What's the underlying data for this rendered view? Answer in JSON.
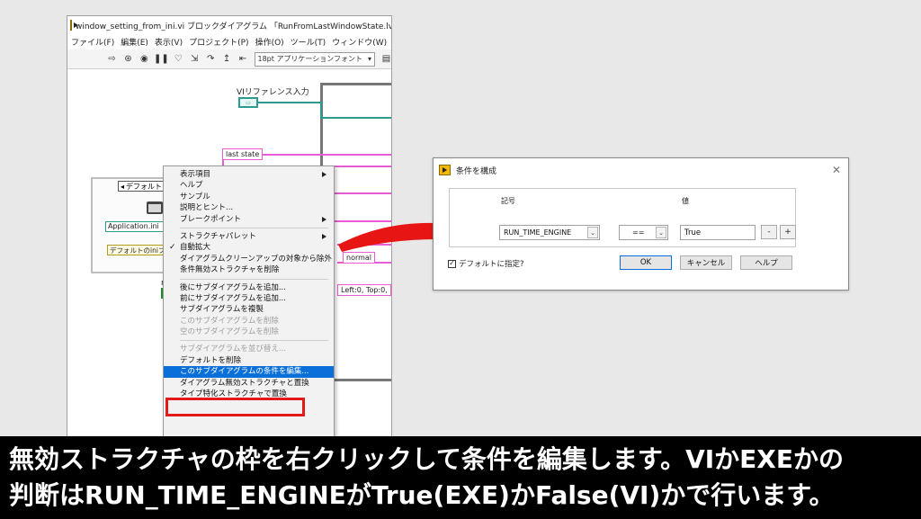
{
  "main_window": {
    "title": "window_setting_from_ini.vi ブロックダイアグラム 「RunFromLastWindowState.lvproj/マイ",
    "menu": [
      "ファイル(F)",
      "編集(E)",
      "表示(V)",
      "プロジェクト(P)",
      "操作(O)",
      "ツール(T)",
      "ウィンドウ(W)",
      "ヘル"
    ],
    "toolbar": {
      "font_select": "18pt アプリケーションフォント",
      "icons": [
        "run-arrow-icon",
        "retain-wire-icon",
        "abort-icon",
        "pause-icon",
        "highlight-bulb-icon",
        "step-into-icon",
        "step-over-icon",
        "step-out-icon",
        "align-icon"
      ]
    },
    "diagram": {
      "vi_ref_label": "VIリファレンス入力",
      "last_state": "last state",
      "normal": "normal",
      "left_top": "Left:0, Top:0,",
      "case_selector": "デフォルト",
      "app_box": "Application.ini",
      "default_ini": "デフォルトのiniフ",
      "small_r": "r"
    }
  },
  "context_menu": {
    "groups": [
      [
        {
          "label": "表示項目",
          "submenu": true,
          "disabled": false
        },
        {
          "label": "ヘルプ",
          "submenu": false,
          "disabled": false
        },
        {
          "label": "サンプル",
          "submenu": false,
          "disabled": false
        },
        {
          "label": "説明とヒント...",
          "submenu": false,
          "disabled": false
        },
        {
          "label": "ブレークポイント",
          "submenu": true,
          "disabled": false
        }
      ],
      [
        {
          "label": "ストラクチャパレット",
          "submenu": true,
          "disabled": false
        },
        {
          "label": "自動拡大",
          "submenu": false,
          "disabled": false,
          "checked": true
        },
        {
          "label": "ダイアグラムクリーンアップの対象から除外",
          "submenu": false,
          "disabled": false
        },
        {
          "label": "条件無効ストラクチャを削除",
          "submenu": false,
          "disabled": false
        }
      ],
      [
        {
          "label": "後にサブダイアグラムを追加...",
          "submenu": false,
          "disabled": false
        },
        {
          "label": "前にサブダイアグラムを追加...",
          "submenu": false,
          "disabled": false
        },
        {
          "label": "サブダイアグラムを複製",
          "submenu": false,
          "disabled": false
        },
        {
          "label": "このサブダイアグラムを削除",
          "submenu": false,
          "disabled": true
        },
        {
          "label": "空のサブダイアグラムを削除",
          "submenu": false,
          "disabled": true
        }
      ],
      [
        {
          "label": "サブダイアグラムを並び替え...",
          "submenu": false,
          "disabled": true
        },
        {
          "label": "デフォルトを削除",
          "submenu": false,
          "disabled": false
        },
        {
          "label": "このサブダイアグラムの条件を編集...",
          "submenu": false,
          "disabled": false,
          "highlighted": true
        },
        {
          "label": "ダイアグラム無効ストラクチャと置換",
          "submenu": false,
          "disabled": false
        },
        {
          "label": "タイプ特化ストラクチャで置換",
          "submenu": false,
          "disabled": false
        }
      ]
    ]
  },
  "dialog": {
    "title": "条件を構成",
    "col_symbol": "記号",
    "col_value": "値",
    "symbol_value": "RUN_TIME_ENGINE",
    "operator_value": "==",
    "value_field": "True",
    "minus": "-",
    "plus": "+",
    "default_checkbox": "デフォルトに指定?",
    "default_checked": true,
    "ok": "OK",
    "cancel": "キャンセル",
    "help": "ヘルプ"
  },
  "caption": {
    "line1": "無効ストラクチャの枠を右クリックして条件を編集します。VIかEXEかの",
    "line2": "判断はRUN_TIME_ENGINEがTrue(EXE)かFalse(VI)かで行います。"
  },
  "colors": {
    "wire_pink": "#e85cd6",
    "wire_teal": "#2d9b8f",
    "highlight": "#0a6fd8",
    "red_box": "#e21a1a",
    "arrow": "#e81515"
  }
}
